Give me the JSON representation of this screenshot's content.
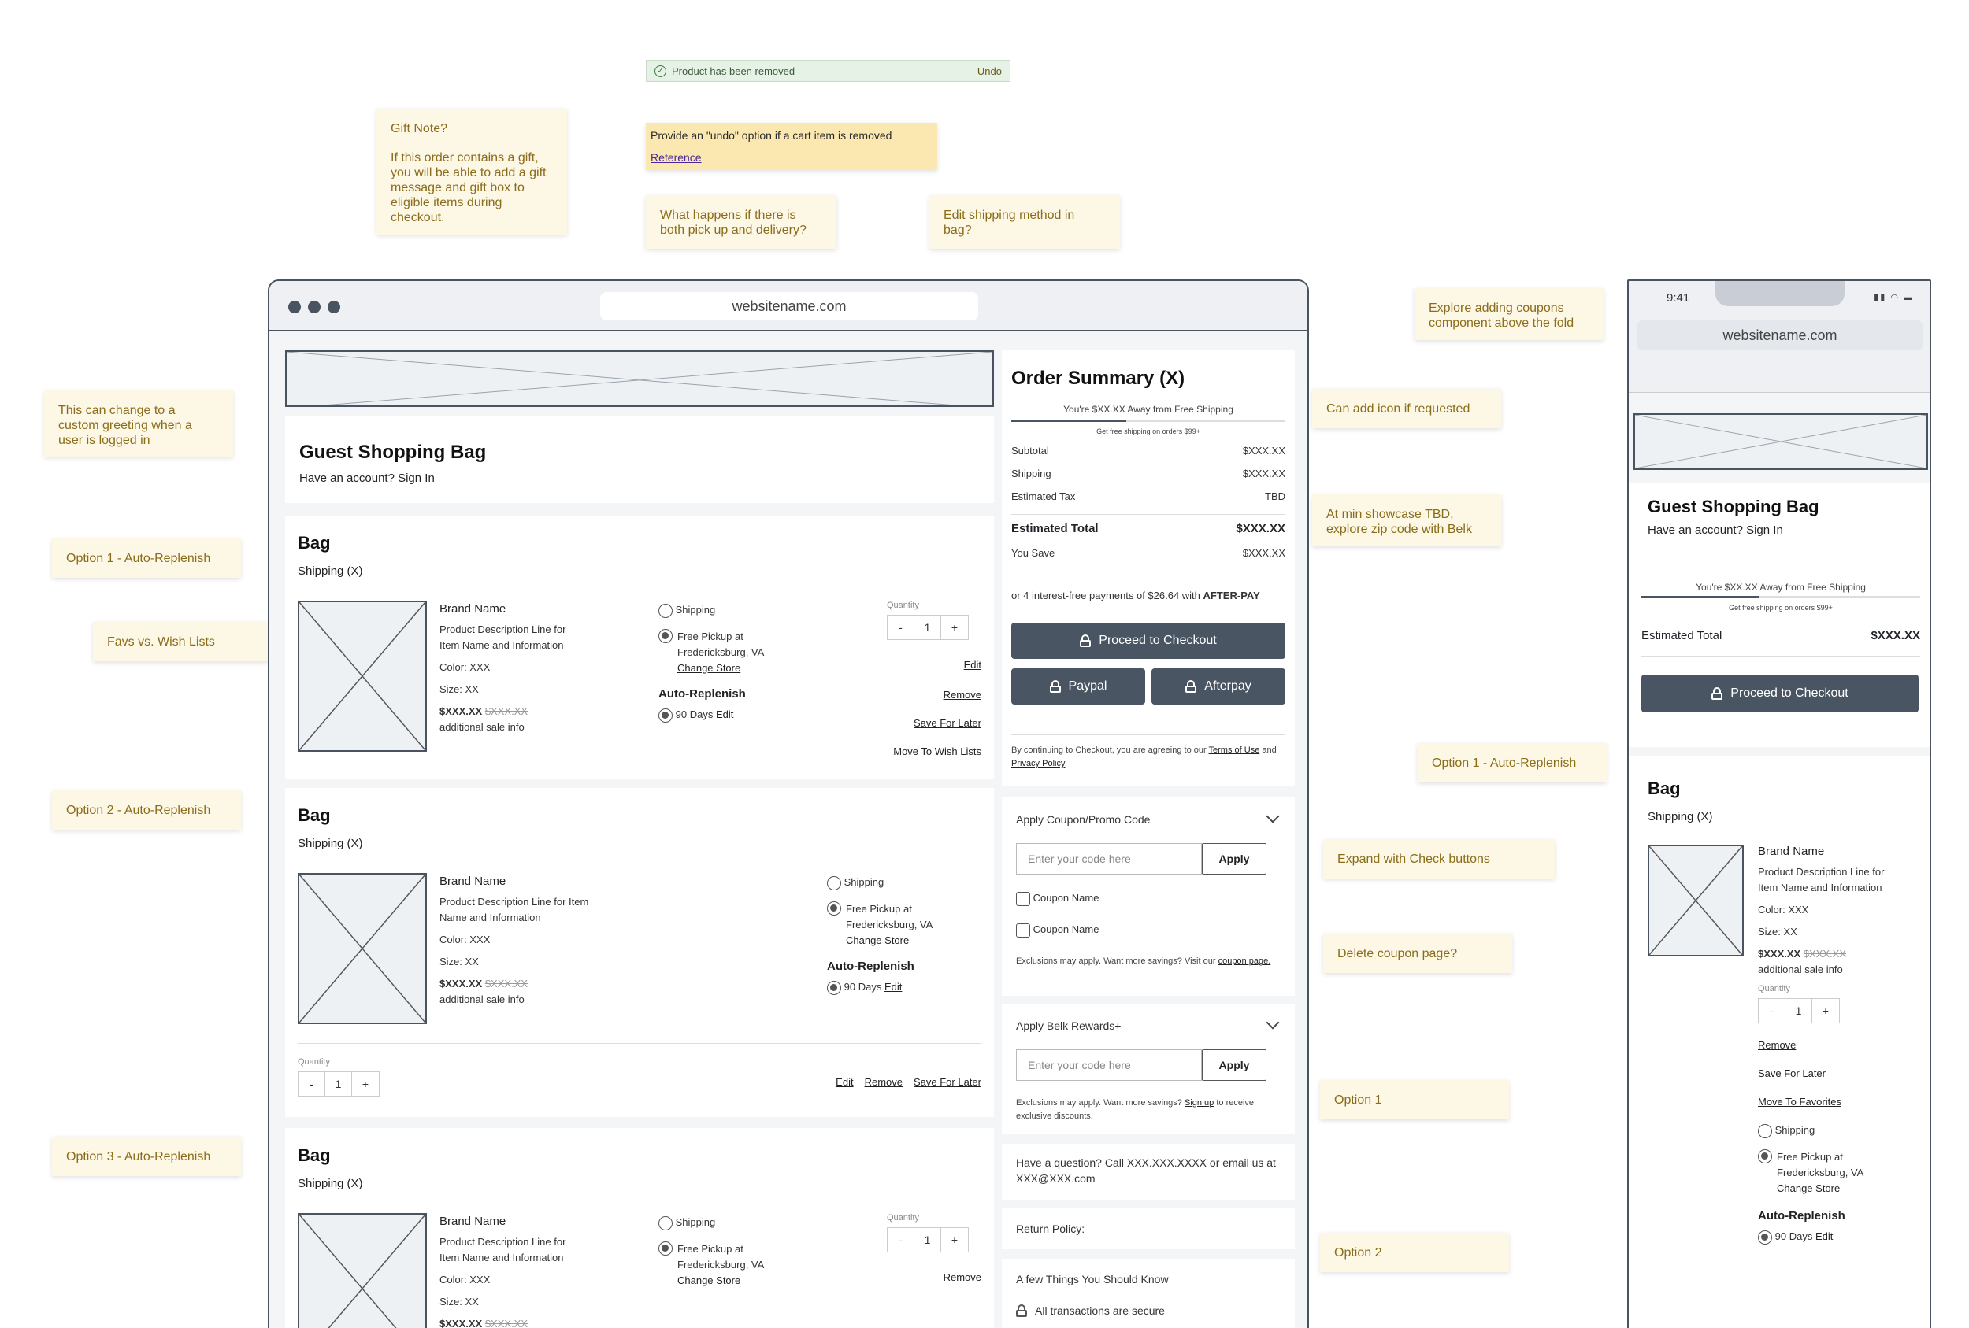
{
  "toast": {
    "message": "Product has been removed",
    "undo": "Undo"
  },
  "notes": {
    "gift_title": "Gift Note?",
    "gift_body": "If this order contains a gift, you will be able to add a gift message and gift box to eligible items during checkout.",
    "undo_note": "Provide an \"undo\" option if a cart item is removed",
    "undo_ref": "Reference",
    "pickup_delivery": "What happens if there is both pick up and delivery?",
    "edit_shipping": "Edit shipping method in bag?",
    "coupons_above_fold": "Explore adding coupons component above the fold",
    "greeting": "This can change to a custom greeting when a user is logged in",
    "opt1": "Option 1 - Auto-Replenish",
    "favs": "Favs vs. Wish Lists",
    "opt2": "Option 2 - Auto-Replenish",
    "opt3": "Option 3 - Auto-Replenish",
    "add_icon": "Can add icon if requested",
    "zip_code": "At min showcase TBD, explore zip code with Belk",
    "expand_check": "Expand with Check buttons",
    "delete_coupon": "Delete coupon page?",
    "option1": "Option 1",
    "option2": "Option 2",
    "mobile_opt1": "Option 1 - Auto-Replenish"
  },
  "browser": {
    "url": "websitename.com"
  },
  "page": {
    "title": "Guest Shopping Bag",
    "have_account": "Have an account?",
    "sign_in": "Sign In"
  },
  "bag": {
    "title": "Bag",
    "shipping_count": "Shipping (X)",
    "brand": "Brand Name",
    "desc1": "Product Description Line for",
    "desc2": "Item Name and Information",
    "desc_alt1": "Product Description Line for Item",
    "desc_alt2": "Name and Information",
    "color": "Color: XXX",
    "size": "Size: XX",
    "price": "$XXX.XX",
    "orig_price": "$XXX.XX",
    "sale_info": "additional sale info",
    "shipping": "Shipping",
    "pickup1": "Free Pickup at",
    "pickup2": "Fredericksburg, VA",
    "change_store": "Change Store",
    "auto_replenish": "Auto-Replenish",
    "days": "90 Days",
    "edit": "Edit",
    "quantity": "Quantity",
    "qty_minus": "-",
    "qty_value": "1",
    "qty_plus": "+",
    "remove": "Remove",
    "save_later": "Save For Later",
    "move_wish": "Move To Wish Lists",
    "move_fav": "Move To Favorites"
  },
  "summary": {
    "title": "Order Summary (X)",
    "away": "You're $XX.XX Away from Free Shipping",
    "free_ship": "Get free shipping on orders $99+",
    "progress": 0.42,
    "subtotal_l": "Subtotal",
    "subtotal_v": "$XXX.XX",
    "shipping_l": "Shipping",
    "shipping_v": "$XXX.XX",
    "tax_l": "Estimated Tax",
    "tax_v": "TBD",
    "total_l": "Estimated Total",
    "total_v": "$XXX.XX",
    "save_l": "You Save",
    "save_v": "$XXX.XX",
    "afterpay_text": "or 4 interest-free payments of $26.64 with",
    "afterpay_brand": "AFTER-PAY",
    "checkout": "Proceed to Checkout",
    "paypal": "Paypal",
    "afterpay": "Afterpay",
    "terms_a": "By continuing to Checkout, you are agreeing to our",
    "terms_link": "Terms of Use",
    "terms_and": "and",
    "privacy": "Privacy Policy"
  },
  "coupon": {
    "title": "Apply Coupon/Promo Code",
    "placeholder": "Enter your code here",
    "apply": "Apply",
    "coupon1": "Coupon Name",
    "coupon2": "Coupon Name",
    "excl": "Exclusions may apply. Want more savings? Visit our",
    "coupon_page": "coupon page."
  },
  "rewards": {
    "title": "Apply Belk Rewards+",
    "placeholder": "Enter your code here",
    "apply": "Apply",
    "excl_a": "Exclusions may apply. Want more savings?",
    "sign_up": "Sign up",
    "excl_b": "to receive exclusive discounts."
  },
  "help": {
    "question": "Have a question? Call XXX.XXX.XXXX or email us at XXX@XXX.com",
    "return_policy": "Return Policy:",
    "things": "A few Things You Should Know",
    "secure": "All transactions are secure"
  },
  "mobile": {
    "time": "9:41",
    "url": "websitename.com",
    "title": "Guest Shopping Bag",
    "away": "You're $XX.XX Away from Free Shipping",
    "free_ship": "Get free shipping on orders $99+",
    "total_l": "Estimated Total",
    "total_v": "$XXX.XX",
    "checkout": "Proceed to Checkout"
  }
}
